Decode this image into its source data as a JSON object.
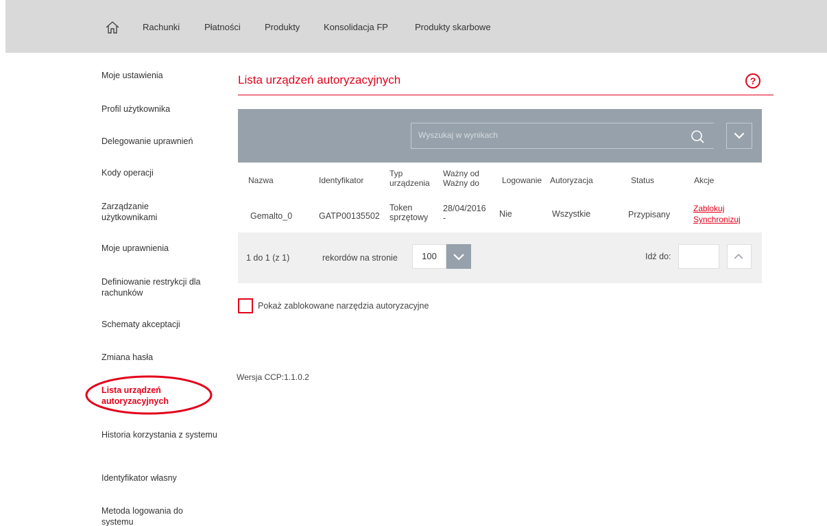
{
  "topnav": {
    "items": [
      "Rachunki",
      "Płatności",
      "Produkty",
      "Konsolidacja FP",
      "Produkty skarbowe"
    ]
  },
  "sidebar": {
    "items": [
      "Moje ustawienia",
      "Profil użytkownika",
      "Delegowanie uprawnień",
      "Kody operacji",
      "Zarządzanie użytkownikami",
      "Moje uprawnienia",
      "Definiowanie restrykcji dla rachunków",
      "Schematy akceptacji",
      "Zmiana hasła",
      "Lista urządzeń autoryzacyjnych",
      "Historia korzystania z systemu",
      "Identyfikator własny",
      "Metoda logowania do systemu"
    ],
    "active_index": 9
  },
  "main": {
    "title": "Lista urządzeń autoryzacyjnych",
    "help_label": "?",
    "search": {
      "placeholder": "Wyszukaj w wynikach"
    },
    "table": {
      "headers": {
        "nazwa": "Nazwa",
        "identyfikator": "Identyfikator",
        "typ": "Typ urządzenia",
        "wazny": "Ważny od Ważny do",
        "logowanie": "Logowanie",
        "autoryzacja": "Autoryzacja",
        "status": "Status",
        "akcje": "Akcje"
      },
      "rows": [
        {
          "nazwa": "Gemalto_0",
          "identyfikator": "GATP00135502",
          "typ": "Token sprzętowy",
          "wazny_od": "28/04/2016",
          "wazny_do": "-",
          "logowanie": "Nie",
          "autoryzacja": "Wszystkie",
          "status": "Przypisany",
          "akcje": [
            "Zablokuj",
            "Synchronizuj"
          ]
        }
      ]
    },
    "pager": {
      "range": "1 do 1 (z 1)",
      "per_page_label": "rekordów na stronie",
      "per_page_value": "100",
      "goto_label": "Idź do:",
      "goto_value": ""
    },
    "show_blocked_label": "Pokaż zablokowane narzędzia autoryzacyjne",
    "show_blocked_checked": false,
    "version": "Wersja CCP:1.1.0.2"
  },
  "colors": {
    "accent": "#e2001a",
    "toolbar": "#97a1ab",
    "topbar": "#d9d9d9",
    "pager": "#f0f0f0"
  }
}
